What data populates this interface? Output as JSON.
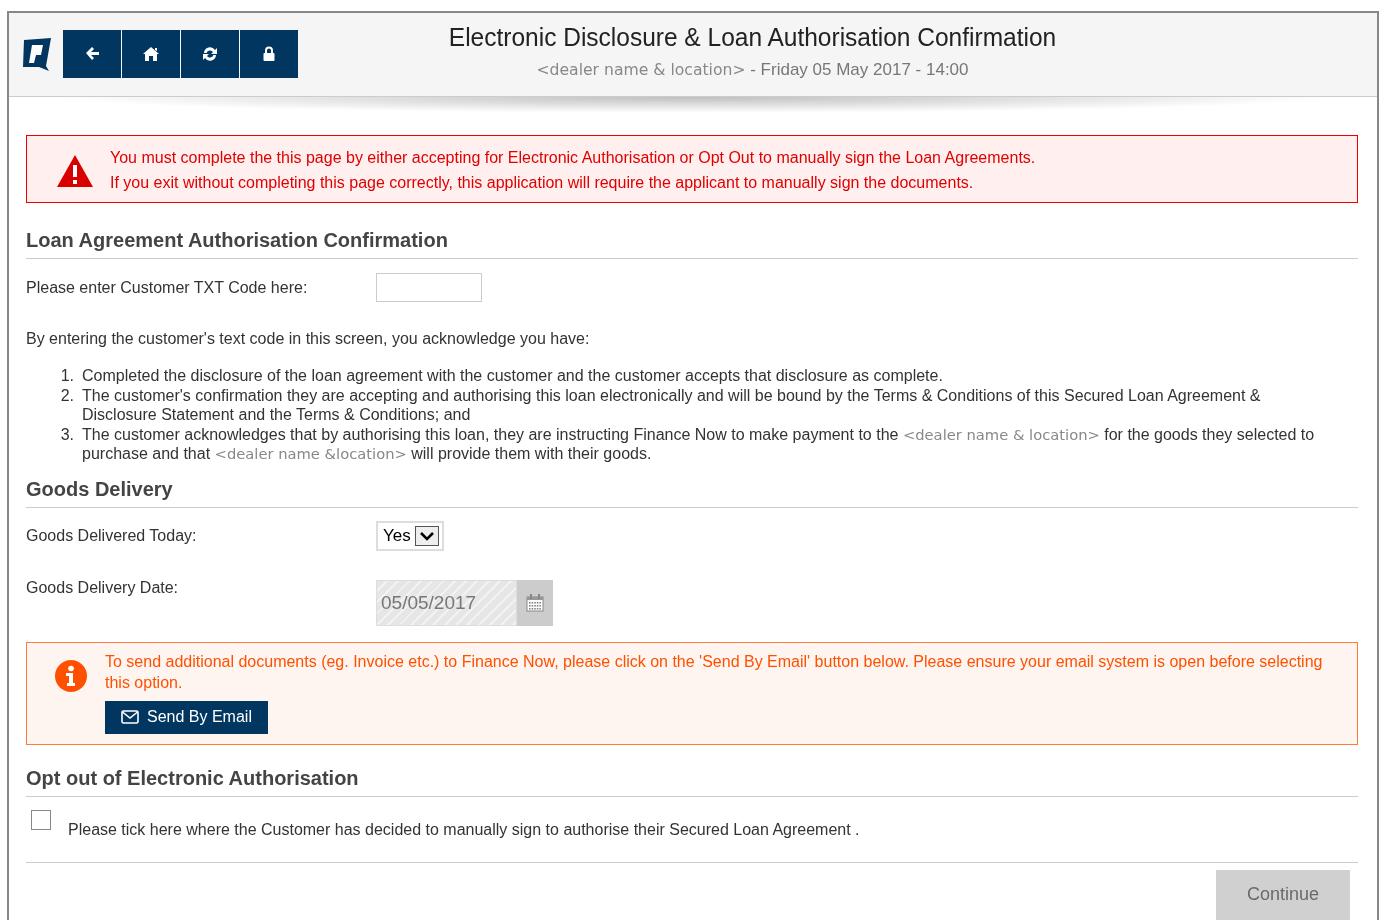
{
  "header": {
    "title": "Electronic Disclosure & Loan Authorisation Confirmation",
    "subtitle": [
      {
        "kind": "placeholder",
        "text": "<dealer name & location>"
      },
      {
        "kind": "plain",
        "text": " - Friday 05 May 2017 - 14:00"
      }
    ],
    "nav_buttons": [
      {
        "kind": "back"
      },
      {
        "kind": "home"
      },
      {
        "kind": "refresh"
      },
      {
        "kind": "lock"
      }
    ]
  },
  "warning": {
    "lines": [
      "You must complete the this page by either accepting for Electronic Authorisation or Opt Out to manually sign the Loan Agreements.",
      "If you exit without completing this page correctly, this application will require the applicant to manually sign the documents."
    ]
  },
  "authorisation": {
    "heading": "Loan Agreement Authorisation Confirmation",
    "code_label": "Please enter Customer TXT Code here:",
    "intro": "By entering the customer's text code in this screen, you acknowledge you have:",
    "items": [
      {
        "number": "1.",
        "parts": [
          {
            "kind": "plain",
            "text": "Completed the disclosure of the loan agreement with the customer and the customer accepts that disclosure as complete."
          }
        ]
      },
      {
        "number": "2.",
        "parts": [
          {
            "kind": "plain",
            "text": "The customer's confirmation they are accepting and authorising this loan electronically and will be bound by the Terms & Conditions of this Secured Loan Agreement & Disclosure Statement and the Terms & Conditions; and"
          }
        ]
      },
      {
        "number": "3.",
        "parts": [
          {
            "kind": "plain",
            "text": "The customer acknowledges that by authorising this loan, they are instructing Finance Now to make payment to the "
          },
          {
            "kind": "placeholder",
            "text": "<dealer name & location>"
          },
          {
            "kind": "plain",
            "text": " for the goods they selected to purchase and that "
          },
          {
            "kind": "placeholder",
            "text": "<dealer name &location>"
          },
          {
            "kind": "plain",
            "text": " will provide them with their goods."
          }
        ]
      }
    ]
  },
  "delivery": {
    "heading": "Goods Delivery",
    "today_label": "Goods Delivered Today:",
    "today_value": "Yes",
    "date_label": "Goods Delivery Date:",
    "date_value": "05/05/2017",
    "date_disabled": true
  },
  "info": {
    "text": "To send additional documents (eg. Invoice etc.) to Finance Now, please click on the 'Send By Email' button below. Please ensure your email system is open before selecting this option.",
    "button": "Send By Email"
  },
  "opt_out": {
    "heading": "Opt out of Electronic Authorisation",
    "label": "Please tick here where the Customer has decided to manually sign to authorise their Secured Loan Agreement .",
    "checked": false
  },
  "continue": {
    "label": "Continue",
    "disabled": true
  }
}
